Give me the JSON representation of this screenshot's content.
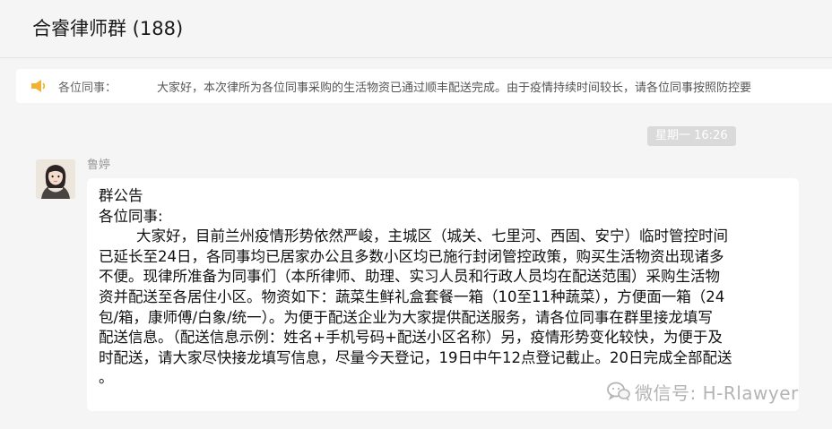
{
  "header": {
    "title": "合睿律师群 (188)"
  },
  "notice": {
    "icon": "megaphone-icon",
    "label": "各位同事：",
    "text": "大家好，本次律所为各位同事采购的生活物资已通过顺丰配送完成。由于疫情持续时间较长，请各位同事按照防控要"
  },
  "chat": {
    "timestamp": "星期一 16:26",
    "message": {
      "sender": "鲁婷",
      "lines": [
        "群公告",
        "各位同事:",
        "        大家好，目前兰州疫情形势依然严峻，主城区（城关、七里河、西固、安宁）临时管控时间",
        "已延长至24日，各同事均已居家办公且多数小区均已施行封闭管控政策，购买生活物资出现诸多",
        "不便。现律所准备为同事们（本所律师、助理、实习人员和行政人员均在配送范围）采购生活物",
        "资并配送至各居住小区。物资如下：蔬菜生鲜礼盒套餐一箱（10至11种蔬菜），方便面一箱（24",
        "包/箱，康师傅/白象/统一）。为便于配送企业为大家提供配送服务，请各位同事在群里接龙填写",
        "配送信息。（配送信息示例：姓名+手机号码+配送小区名称）另，疫情形势变化较快，为便于及",
        "时配送，请大家尽快接龙填写信息，尽量今天登记，19日中午12点登记截止。20日完成全部配送",
        "。"
      ]
    }
  },
  "watermark": {
    "icon": "wechat-search-icon",
    "text": "微信号: H-Rlawyer"
  },
  "colors": {
    "background": "#f5f5f5",
    "bubble": "#ffffff",
    "notice_icon": "#f2b233",
    "timestamp_bg": "#dadada"
  }
}
